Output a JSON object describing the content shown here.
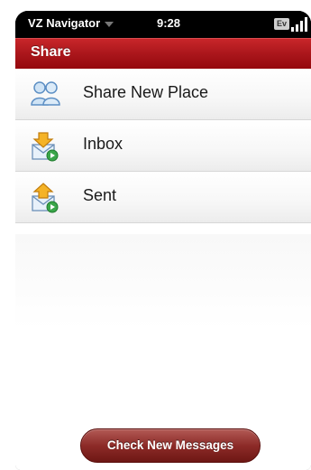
{
  "status_bar": {
    "app_name": "VZ Navigator",
    "time": "9:28",
    "ev_badge": "Ev"
  },
  "header": {
    "title": "Share"
  },
  "list": {
    "items": [
      {
        "label": "Share New Place",
        "icon": "people-icon"
      },
      {
        "label": "Inbox",
        "icon": "inbox-envelope-icon"
      },
      {
        "label": "Sent",
        "icon": "sent-envelope-icon"
      }
    ]
  },
  "footer": {
    "check_button_label": "Check New Messages"
  },
  "colors": {
    "title_bar": "#b01c20",
    "button": "#8d2b28",
    "status_bar": "#000000"
  }
}
